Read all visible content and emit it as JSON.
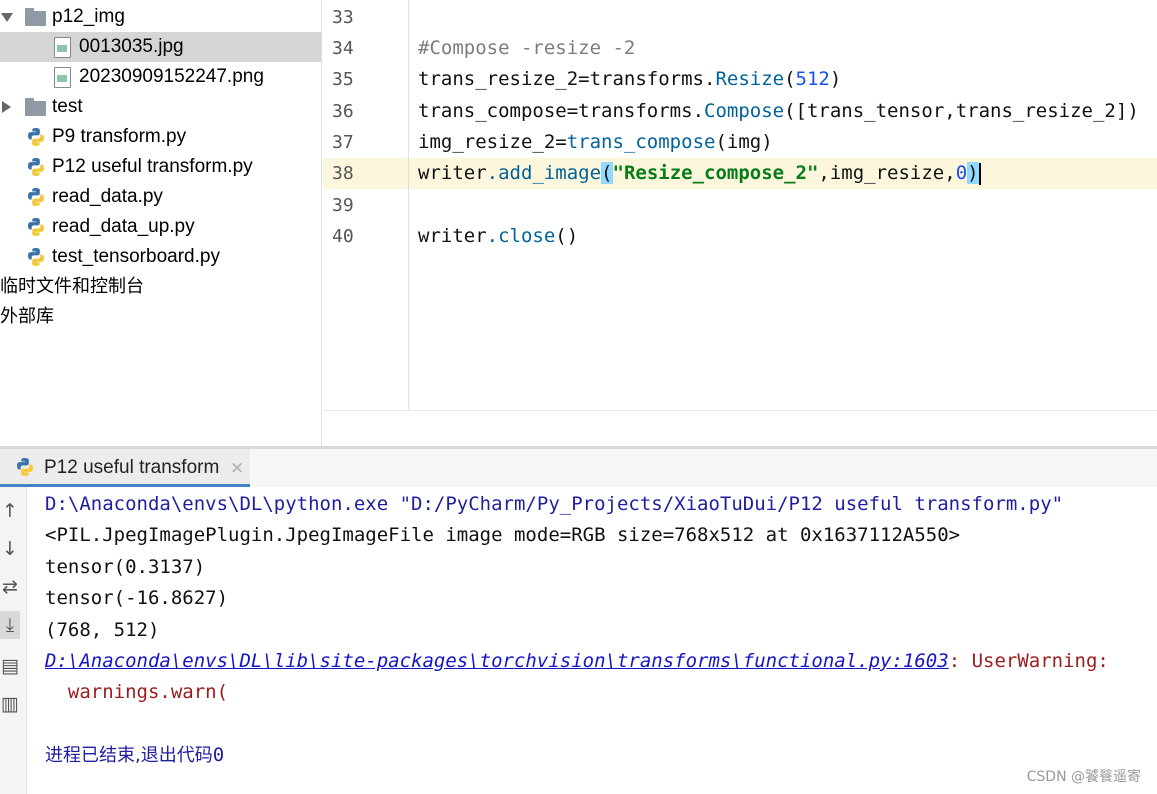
{
  "tree": {
    "items": [
      {
        "label": "p12_img"
      },
      {
        "label": "0013035.jpg"
      },
      {
        "label": "20230909152247.png"
      },
      {
        "label": "test"
      },
      {
        "label": "P9 transform.py"
      },
      {
        "label": "P12 useful transform.py"
      },
      {
        "label": "read_data.py"
      },
      {
        "label": "read_data_up.py"
      },
      {
        "label": "test_tensorboard.py"
      },
      {
        "label": "临时文件和控制台"
      },
      {
        "label": "外部库"
      }
    ]
  },
  "editor": {
    "line_numbers": [
      "33",
      "34",
      "35",
      "36",
      "37",
      "38",
      "39",
      "40"
    ],
    "code": {
      "l34": "#Compose -resize -2",
      "l35_a": "trans_resize_2",
      "l35_b": "=",
      "l35_c": "transforms",
      "l35_d": ".",
      "l35_e": "Resize",
      "l35_f": "(",
      "l35_g": "512",
      "l35_h": ")",
      "l36_a": "trans_compose",
      "l36_b": "=",
      "l36_c": "transforms",
      "l36_d": ".",
      "l36_e": "Compose",
      "l36_f": "([",
      "l36_g": "trans_tensor",
      "l36_h": ",",
      "l36_i": "trans_resize_2",
      "l36_j": "])",
      "l37_a": "img_resize_2",
      "l37_b": "=",
      "l37_c": "trans_compose",
      "l37_d": "(",
      "l37_e": "img",
      "l37_f": ")",
      "l38_a": "writer",
      "l38_b": ".",
      "l38_c": "add_image",
      "l38_d": "(",
      "l38_e": "\"Resize_compose_2\"",
      "l38_f": ",",
      "l38_g": "img_resize",
      "l38_h": ",",
      "l38_i": "0",
      "l38_j": ")",
      "l40_a": "writer",
      "l40_b": ".",
      "l40_c": "close",
      "l40_d": "()"
    },
    "current_line": "38"
  },
  "run_panel": {
    "tab_label": "P12 useful transform",
    "tab_close": "×"
  },
  "toolbar": {
    "icons": [
      "arrow-up-icon",
      "arrow-down-icon",
      "soft-wrap-icon",
      "scroll-to-end-icon",
      "print-icon",
      "trash-icon"
    ],
    "glyphs": {
      "up": "↑",
      "down": "↓",
      "wrap": "⇄",
      "end": "⤓",
      "print": "▤",
      "trash": "▥"
    }
  },
  "console": {
    "cmd": "D:\\Anaconda\\envs\\DL\\python.exe \"D:/PyCharm/Py_Projects/XiaoTuDui/P12 useful transform.py\"",
    "out1": "<PIL.JpegImagePlugin.JpegImageFile image mode=RGB size=768x512 at 0x1637112A550>",
    "out2": "tensor(0.3137)",
    "out3": "tensor(-16.8627)",
    "out4": "(768, 512)",
    "warn_link": "D:\\Anaconda\\envs\\DL\\lib\\site-packages\\torchvision\\transforms\\functional.py:1603",
    "warn_text": ": UserWarning:",
    "warn_call": "  warnings.warn(",
    "exit_text": "进程已结束,退出代码",
    "exit_code": "0"
  },
  "watermark": "CSDN @饕餮遥寄",
  "colors": {
    "selection": "#d5d5d5",
    "current_line": "#fcf7dc",
    "bracket_match": "#93d9ff",
    "method_teal": "#00629a",
    "number_blue": "#1750eb",
    "string_green": "#067d17",
    "link_blue": "#1515c8",
    "warning_red": "#9b1c1c",
    "tab_underline": "#4083c9"
  }
}
